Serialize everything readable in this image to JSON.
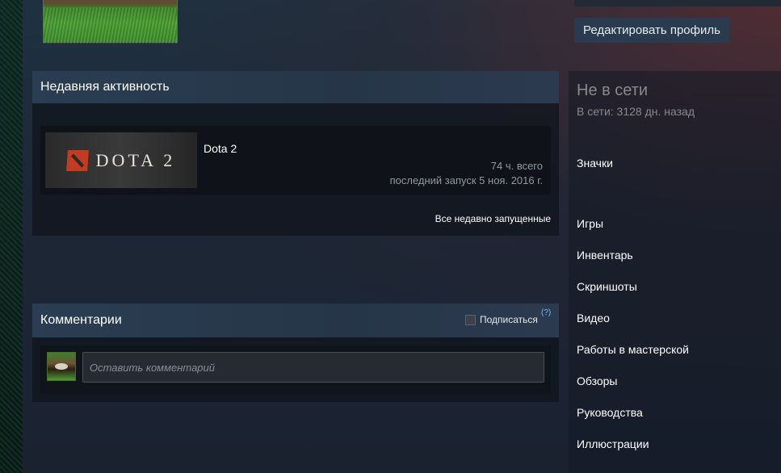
{
  "profile": {
    "edit_button": "Редактировать профиль"
  },
  "recent_activity": {
    "title": "Недавняя активность",
    "game": {
      "capsule_text": "DOTA 2",
      "name": "Dota 2",
      "hours": "74 ч. всего",
      "last_played": "последний запуск 5 ноя. 2016 г."
    },
    "all_recent_link": "Все недавно запущенные"
  },
  "comments": {
    "title": "Комментарии",
    "subscribe_label": "Подписаться",
    "help": "(?)",
    "input_placeholder": "Оставить комментарий"
  },
  "status": {
    "title": "Не в сети",
    "last_online": "В сети: 3128 дн. назад"
  },
  "nav": {
    "badges": "Значки",
    "games": "Игры",
    "inventory": "Инвентарь",
    "screenshots": "Скриншоты",
    "videos": "Видео",
    "workshop": "Работы в мастерской",
    "reviews": "Обзоры",
    "guides": "Руководства",
    "artwork": "Иллюстрации"
  },
  "colors": {
    "accent_blue": "#66c0f4",
    "offline_gray": "#898989",
    "panel_header": "#2a3d52"
  }
}
